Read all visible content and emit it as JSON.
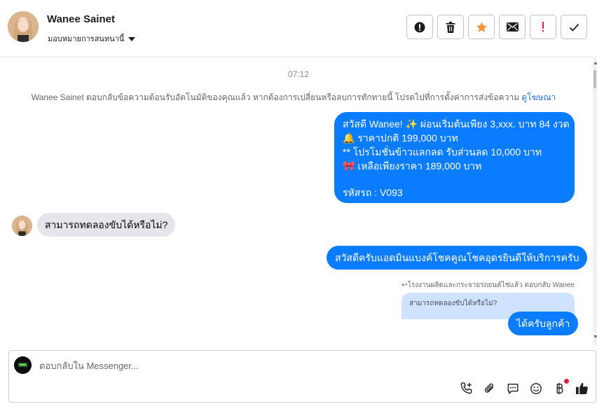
{
  "header": {
    "contact_name": "Wanee Sainet",
    "assign_label": "มอบหมายการสนทนานี้",
    "actions": [
      {
        "name": "report-spam-button",
        "icon": "alert-circle-icon"
      },
      {
        "name": "delete-button",
        "icon": "trash-icon"
      },
      {
        "name": "star-button",
        "icon": "star-icon"
      },
      {
        "name": "mark-unread-button",
        "icon": "envelope-icon"
      },
      {
        "name": "follow-up-button",
        "icon": "exclamation-icon"
      },
      {
        "name": "mark-done-button",
        "icon": "check-icon"
      }
    ],
    "colors": {
      "star": "#f7923b",
      "follow_up": "#e41e3f"
    }
  },
  "conversation": {
    "timestamp": "07:12",
    "system_note": "Wanee Sainet ตอบกลับข้อความต้อนรับอัตโนมัติของคุณแล้ว หากต้องการเปลี่ยนหรือลบการทักทายนี้ โปรดไปที่การตั้งค่าการส่งข้อความ",
    "system_note_link": "ดูโฆษณา",
    "promo_message": {
      "line1": "สวัสดี Wanee! ✨  ผ่อนเริ่มต้นเพียง 3,xxx. บาท 84 งวด",
      "line2": "🔔 ราคาปกติ 199,000 บาท",
      "line3": "** โปรโมชั่นข้าวแลกลด รับส่วนลด 10,000 บาท",
      "line4": "🎀  เหลือเพียงราคา 189,000 บาท",
      "line5": " รหัสรถ : V093"
    },
    "incoming_message": "สามารถทดลองขับได้หรือไม่?",
    "reply_message": "สวัสดีครับแอดมินแบงค์โชคคูณโชคอุดรยินดีให้บริการครับ",
    "reply_meta": "โรงงานผลิตและกระจายรถยนต์ไช่แล้ว ตอบกลับ Wanee",
    "quoted_message": "สามารถทดลองขับได้หรือไม่?",
    "final_reply": "ได้ครับลูกค้า",
    "colors": {
      "outgoing": "#0a7cff",
      "incoming": "#e4e6eb",
      "quoted": "#cfe2ff"
    }
  },
  "composer": {
    "placeholder": "ตอบกลับใน Messenger...",
    "tools": [
      "call-plus-icon",
      "paperclip-icon",
      "saved-replies-icon",
      "emoji-icon",
      "baht-payment-icon",
      "thumbs-up-icon"
    ]
  }
}
